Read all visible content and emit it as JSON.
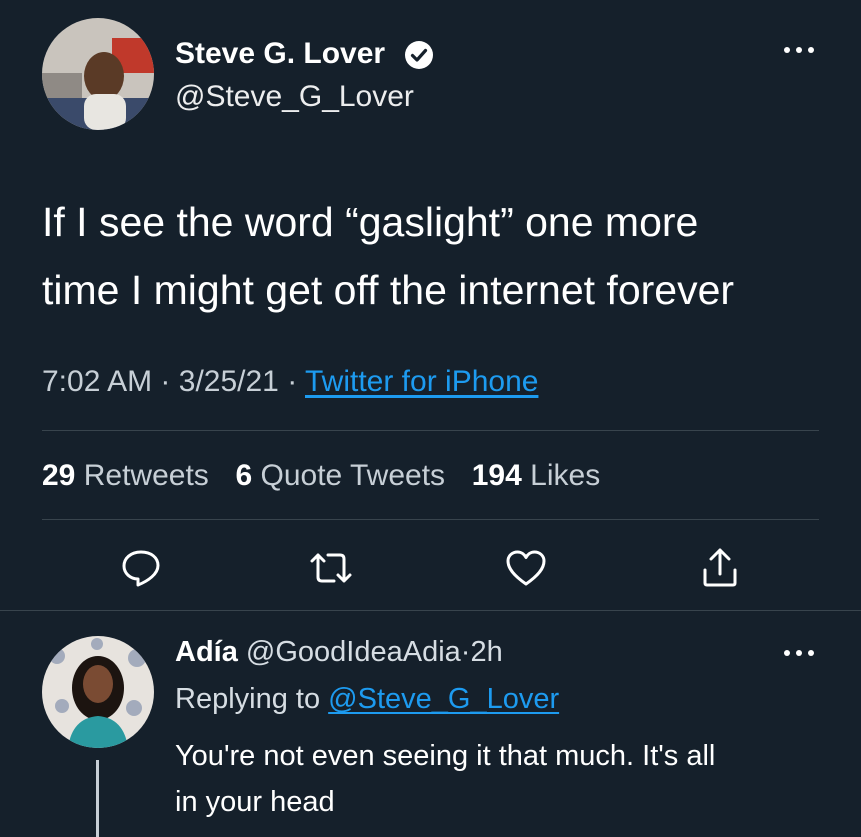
{
  "colors": {
    "background": "#15202b",
    "text": "#ffffff",
    "muted": "#8b98a5",
    "accent": "#1d9bf0",
    "divider": "#38444d"
  },
  "tweet": {
    "author_name": "Steve G. Lover",
    "author_handle": "@Steve_G_Lover",
    "verified_icon": "verified-badge-icon",
    "text_line1": "If I see the word “gaslight” one more",
    "text_line2": "time I might get off the internet forever",
    "time": "7:02 AM",
    "date": "3/25/21",
    "separator": "·",
    "source": "Twitter for iPhone",
    "stats": {
      "retweets_count": "29",
      "retweets_label": "Retweets",
      "quotes_count": "6",
      "quotes_label": "Quote Tweets",
      "likes_count": "194",
      "likes_label": "Likes"
    },
    "actions": [
      "reply-icon",
      "retweet-icon",
      "like-icon",
      "share-icon"
    ],
    "more_icon": "more-icon"
  },
  "reply": {
    "author_name": "Adía",
    "author_handle": "@GoodIdeaAdia",
    "separator": "·",
    "age": "2h",
    "replying_prefix": "Replying to",
    "replying_to": "@Steve_G_Lover",
    "text_line1": "You're not even seeing it that much. It's all",
    "text_line2": "in your head",
    "more_icon": "more-icon"
  }
}
